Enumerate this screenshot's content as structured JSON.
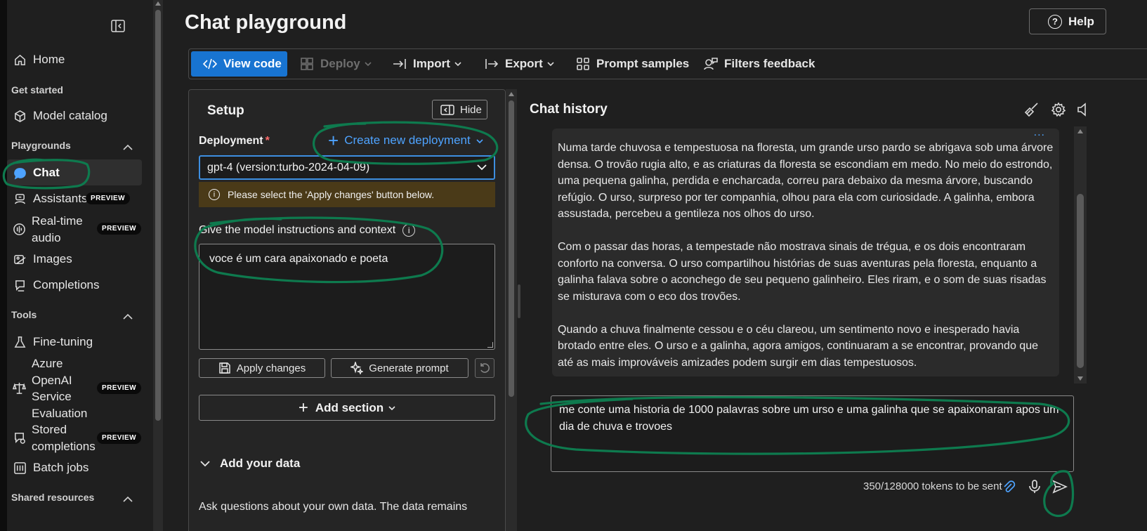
{
  "sidebar": {
    "home": "Home",
    "get_started": "Get started",
    "model_catalog": "Model catalog",
    "playgrounds": "Playgrounds",
    "chat": "Chat",
    "assistants": "Assistants",
    "realtime_line1": "Real-time",
    "realtime_line2": "audio",
    "images": "Images",
    "completions": "Completions",
    "tools": "Tools",
    "fine_tuning": "Fine-tuning",
    "aoai_line1": "Azure",
    "aoai_line2": "OpenAI",
    "aoai_line3": "Service",
    "aoai_line4": "Evaluation",
    "stored_line1": "Stored",
    "stored_line2": "completions",
    "batch_jobs": "Batch jobs",
    "shared_resources": "Shared resources",
    "preview_badge": "PREVIEW"
  },
  "header": {
    "title": "Chat playground",
    "help": "Help",
    "help_glyph": "?"
  },
  "toolbar": {
    "view_code": "View code",
    "deploy": "Deploy",
    "import": "Import",
    "export": "Export",
    "prompt_samples": "Prompt samples",
    "filters_feedback": "Filters feedback"
  },
  "setup": {
    "title": "Setup",
    "hide": "Hide",
    "deployment_label": "Deployment",
    "required_mark": "*",
    "create_deployment": "Create new deployment",
    "deployment_value": "gpt-4 (version:turbo-2024-04-09)",
    "warning": "Please select the 'Apply changes' button below.",
    "instructions_label": "Give the model instructions and context",
    "system_message": "voce é um cara apaixonado e poeta",
    "apply_changes": "Apply changes",
    "generate_prompt": "Generate prompt",
    "add_section": "Add section",
    "add_your_data": "Add your data",
    "add_data_text": "Ask questions about your own data. The data remains"
  },
  "chat": {
    "title": "Chat history",
    "more": "...",
    "paragraphs": [
      "Numa tarde chuvosa e tempestuosa na floresta, um grande urso pardo se abrigava sob uma árvore densa. O trovão rugia alto, e as criaturas da floresta se escondiam em medo. No meio do estrondo, uma pequena galinha, perdida e encharcada, correu para debaixo da mesma árvore, buscando refúgio. O urso, surpreso por ter companhia, olhou para ela com curiosidade. A galinha, embora assustada, percebeu a gentileza nos olhos do urso.",
      "Com o passar das horas, a tempestade não mostrava sinais de trégua, e os dois encontraram conforto na conversa. O urso compartilhou histórias de suas aventuras pela floresta, enquanto a galinha falava sobre o aconchego de seu pequeno galinheiro. Eles riram, e o som de suas risadas se misturava com o eco dos trovões.",
      "Quando a chuva finalmente cessou e o céu clareou, um sentimento novo e inesperado havia brotado entre eles. O urso e a galinha, agora amigos, continuaram a se encontrar, provando que até as mais improváveis amizades podem surgir em dias tempestuosos."
    ],
    "user_input": "me conte uma historia de 1000 palavras sobre um urso e uma galinha que se apaixonaram apos um dia de chuva e trovoes",
    "tokens": "350/128000 tokens to be sent"
  },
  "colors": {
    "accent": "#1874d1",
    "link": "#4ea3ff",
    "annotation": "#0e7a4e",
    "warning_bg": "#4a3a18"
  }
}
